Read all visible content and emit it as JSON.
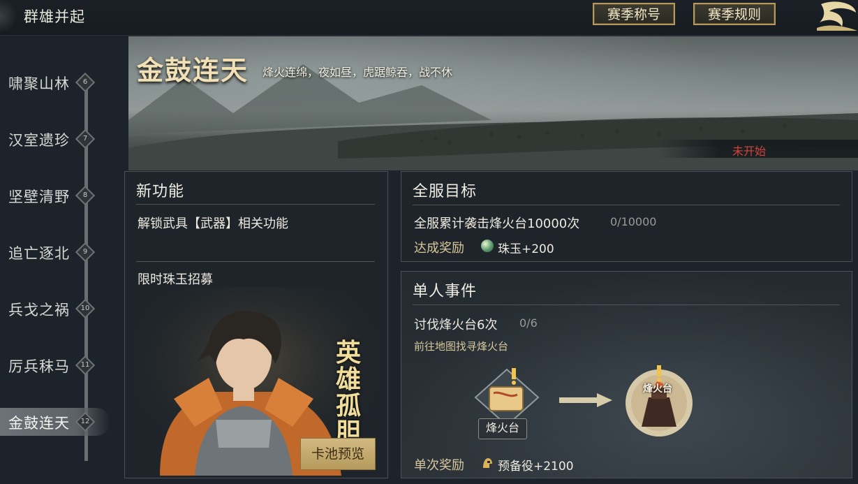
{
  "header": {
    "title": "群雄并起",
    "buttons": {
      "season_title": "赛季称号",
      "season_rules": "赛季规则"
    }
  },
  "sidebar": {
    "items": [
      {
        "label": "啸聚山林",
        "num": "6"
      },
      {
        "label": "汉室遗珍",
        "num": "7"
      },
      {
        "label": "坚壁清野",
        "num": "8"
      },
      {
        "label": "追亡逐北",
        "num": "9"
      },
      {
        "label": "兵戈之祸",
        "num": "10"
      },
      {
        "label": "厉兵秣马",
        "num": "11"
      },
      {
        "label": "金鼓连天",
        "num": "12"
      }
    ],
    "active_index": 6
  },
  "banner": {
    "title": "金鼓连天",
    "subtitle": "烽火连绵，夜如昼，虎踞鲸吞，战不休",
    "status": "未开始"
  },
  "new_features": {
    "title": "新功能",
    "feature_unlock": "解锁武具【武器】相关功能",
    "feature_recruit": "限时珠玉招募",
    "hero_calligraphy": "英雄孤胆",
    "pool_preview_button": "卡池预览"
  },
  "server_goal": {
    "title": "全服目标",
    "goal_text": "全服累计袭击烽火台10000次",
    "progress": "0/10000",
    "reward_label": "达成奖励",
    "reward_icon": "pearl-icon",
    "reward_value": "珠玉+200"
  },
  "single_event": {
    "title": "单人事件",
    "task_text": "讨伐烽火台6次",
    "progress": "0/6",
    "hint": "前往地图找寻烽火台",
    "map_node_label": "烽火台",
    "tower_label": "烽火台",
    "reward_label": "单次奖励",
    "reward_icon": "helmet-icon",
    "reward_value": "预备役+2100"
  },
  "colors": {
    "gold_accent": "#b59a5c",
    "status_red": "#d0443c",
    "reward_label": "#d8c79c"
  }
}
